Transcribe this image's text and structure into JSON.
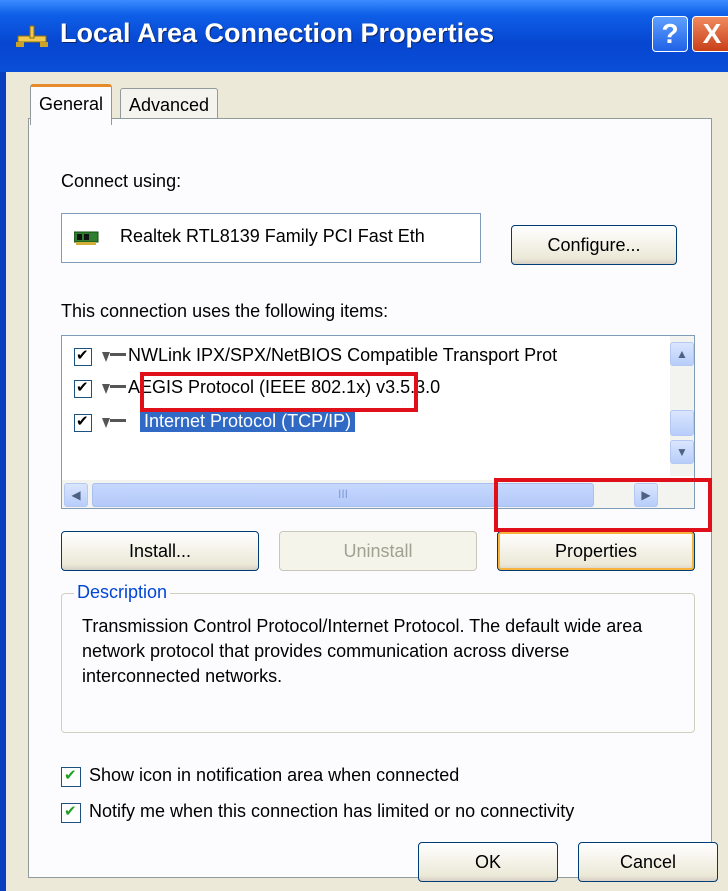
{
  "window": {
    "title": "Local Area Connection Properties",
    "help_label": "?",
    "close_label": "X"
  },
  "tabs": [
    {
      "label": "General"
    },
    {
      "label": "Advanced"
    }
  ],
  "connect_using": {
    "label": "Connect using:",
    "adapter": "Realtek RTL8139 Family PCI Fast Eth",
    "configure_button": "Configure..."
  },
  "items": {
    "label": "This connection uses the following items:",
    "rows": [
      {
        "label": "NWLink IPX/SPX/NetBIOS Compatible Transport Prot",
        "checked": true,
        "selected": false
      },
      {
        "label": "AEGIS Protocol (IEEE 802.1x) v3.5.3.0",
        "checked": true,
        "selected": false
      },
      {
        "label": "Internet Protocol (TCP/IP)",
        "checked": true,
        "selected": true
      }
    ],
    "scroll_up": "▲",
    "scroll_down": "▼",
    "scroll_left": "◀",
    "scroll_right": "▶",
    "thumb_grip": "III"
  },
  "buttons": {
    "install": "Install...",
    "uninstall": "Uninstall",
    "properties": "Properties",
    "ok": "OK",
    "cancel": "Cancel"
  },
  "description": {
    "title": "Description",
    "text": "Transmission Control Protocol/Internet Protocol. The default wide area network protocol that provides communication across diverse interconnected networks."
  },
  "options": [
    {
      "label": "Show icon in notification area when connected",
      "checked": true
    },
    {
      "label": "Notify me when this connection has limited or no connectivity",
      "checked": true
    }
  ],
  "colors": {
    "titlebar": "#0646d0",
    "dialog": "#ece9d8",
    "selection": "#316ac5",
    "highlight": "#e0101a"
  }
}
